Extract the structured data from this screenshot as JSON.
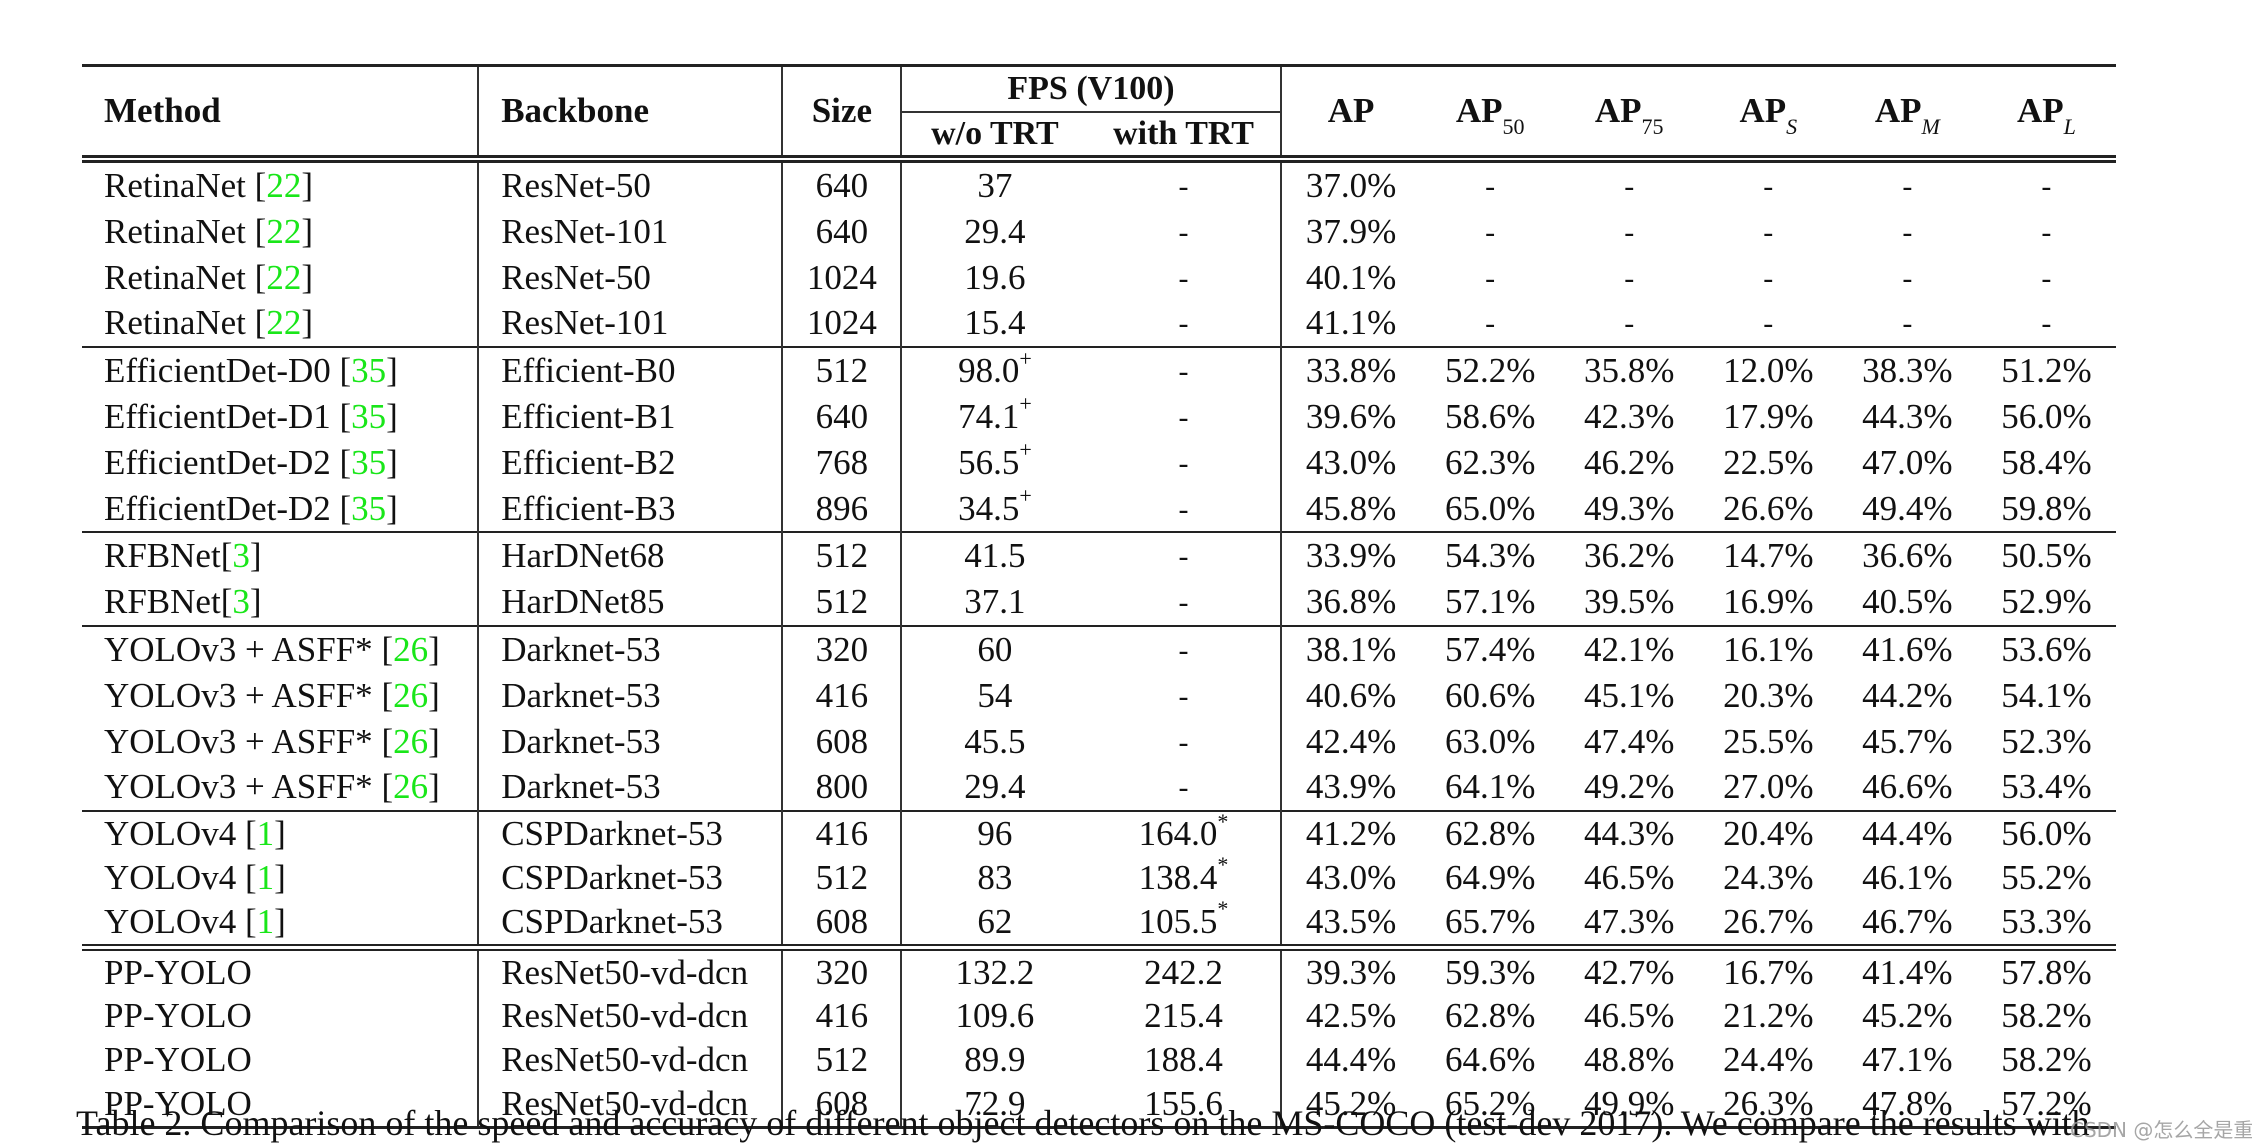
{
  "table": {
    "headers": {
      "method": "Method",
      "backbone": "Backbone",
      "size": "Size",
      "fps_group": "FPS (V100)",
      "fps_wo_trt": "w/o TRT",
      "fps_with_trt": "with TRT",
      "ap": "AP",
      "ap50": {
        "base": "AP",
        "sub": "50"
      },
      "ap75": {
        "base": "AP",
        "sub": "75"
      },
      "aps": {
        "base": "AP",
        "sub": "S"
      },
      "apm": {
        "base": "AP",
        "sub": "M"
      },
      "apl": {
        "base": "AP",
        "sub": "L"
      }
    },
    "groups": [
      {
        "name": "RetinaNet",
        "rows": [
          {
            "method": "RetinaNet ",
            "cite": "22",
            "backbone": "ResNet-50",
            "size": "640",
            "fps": "37",
            "fps_sup": "",
            "fps_trt": "-",
            "fps_trt_sup": "",
            "ap": "37.0%",
            "ap50": "-",
            "ap75": "-",
            "aps": "-",
            "apm": "-",
            "apl": "-"
          },
          {
            "method": "RetinaNet ",
            "cite": "22",
            "backbone": "ResNet-101",
            "size": "640",
            "fps": "29.4",
            "fps_sup": "",
            "fps_trt": "-",
            "fps_trt_sup": "",
            "ap": "37.9%",
            "ap50": "-",
            "ap75": "-",
            "aps": "-",
            "apm": "-",
            "apl": "-"
          },
          {
            "method": "RetinaNet ",
            "cite": "22",
            "backbone": "ResNet-50",
            "size": "1024",
            "fps": "19.6",
            "fps_sup": "",
            "fps_trt": "-",
            "fps_trt_sup": "",
            "ap": "40.1%",
            "ap50": "-",
            "ap75": "-",
            "aps": "-",
            "apm": "-",
            "apl": "-"
          },
          {
            "method": "RetinaNet ",
            "cite": "22",
            "backbone": "ResNet-101",
            "size": "1024",
            "fps": "15.4",
            "fps_sup": "",
            "fps_trt": "-",
            "fps_trt_sup": "",
            "ap": "41.1%",
            "ap50": "-",
            "ap75": "-",
            "aps": "-",
            "apm": "-",
            "apl": "-"
          }
        ]
      },
      {
        "name": "EfficientDet",
        "rows": [
          {
            "method": "EfficientDet-D0 ",
            "cite": "35",
            "backbone": "Efficient-B0",
            "size": "512",
            "fps": "98.0",
            "fps_sup": "+",
            "fps_trt": "-",
            "fps_trt_sup": "",
            "ap": "33.8%",
            "ap50": "52.2%",
            "ap75": "35.8%",
            "aps": "12.0%",
            "apm": "38.3%",
            "apl": "51.2%"
          },
          {
            "method": "EfficientDet-D1 ",
            "cite": "35",
            "backbone": "Efficient-B1",
            "size": "640",
            "fps": "74.1",
            "fps_sup": "+",
            "fps_trt": "-",
            "fps_trt_sup": "",
            "ap": "39.6%",
            "ap50": "58.6%",
            "ap75": "42.3%",
            "aps": "17.9%",
            "apm": "44.3%",
            "apl": "56.0%"
          },
          {
            "method": "EfficientDet-D2 ",
            "cite": "35",
            "backbone": "Efficient-B2",
            "size": "768",
            "fps": "56.5",
            "fps_sup": "+",
            "fps_trt": "-",
            "fps_trt_sup": "",
            "ap": "43.0%",
            "ap50": "62.3%",
            "ap75": "46.2%",
            "aps": "22.5%",
            "apm": "47.0%",
            "apl": "58.4%"
          },
          {
            "method": "EfficientDet-D2 ",
            "cite": "35",
            "backbone": "Efficient-B3",
            "size": "896",
            "fps": "34.5",
            "fps_sup": "+",
            "fps_trt": "-",
            "fps_trt_sup": "",
            "ap": "45.8%",
            "ap50": "65.0%",
            "ap75": "49.3%",
            "aps": "26.6%",
            "apm": "49.4%",
            "apl": "59.8%"
          }
        ]
      },
      {
        "name": "RFBNet",
        "rows": [
          {
            "method": "RFBNet",
            "cite": "3",
            "backbone": "HarDNet68",
            "size": "512",
            "fps": "41.5",
            "fps_sup": "",
            "fps_trt": "-",
            "fps_trt_sup": "",
            "ap": "33.9%",
            "ap50": "54.3%",
            "ap75": "36.2%",
            "aps": "14.7%",
            "apm": "36.6%",
            "apl": "50.5%"
          },
          {
            "method": "RFBNet",
            "cite": "3",
            "backbone": "HarDNet85",
            "size": "512",
            "fps": "37.1",
            "fps_sup": "",
            "fps_trt": "-",
            "fps_trt_sup": "",
            "ap": "36.8%",
            "ap50": "57.1%",
            "ap75": "39.5%",
            "aps": "16.9%",
            "apm": "40.5%",
            "apl": "52.9%"
          }
        ]
      },
      {
        "name": "YOLOv3 + ASFF*",
        "rows": [
          {
            "method": "YOLOv3 + ASFF* ",
            "cite": "26",
            "backbone": "Darknet-53",
            "size": "320",
            "fps": "60",
            "fps_sup": "",
            "fps_trt": "-",
            "fps_trt_sup": "",
            "ap": "38.1%",
            "ap50": "57.4%",
            "ap75": "42.1%",
            "aps": "16.1%",
            "apm": "41.6%",
            "apl": "53.6%"
          },
          {
            "method": "YOLOv3 + ASFF* ",
            "cite": "26",
            "backbone": "Darknet-53",
            "size": "416",
            "fps": "54",
            "fps_sup": "",
            "fps_trt": "-",
            "fps_trt_sup": "",
            "ap": "40.6%",
            "ap50": "60.6%",
            "ap75": "45.1%",
            "aps": "20.3%",
            "apm": "44.2%",
            "apl": "54.1%"
          },
          {
            "method": "YOLOv3 + ASFF* ",
            "cite": "26",
            "backbone": "Darknet-53",
            "size": "608",
            "fps": "45.5",
            "fps_sup": "",
            "fps_trt": "-",
            "fps_trt_sup": "",
            "ap": "42.4%",
            "ap50": "63.0%",
            "ap75": "47.4%",
            "aps": "25.5%",
            "apm": "45.7%",
            "apl": "52.3%"
          },
          {
            "method": "YOLOv3 + ASFF* ",
            "cite": "26",
            "backbone": "Darknet-53",
            "size": "800",
            "fps": "29.4",
            "fps_sup": "",
            "fps_trt": "-",
            "fps_trt_sup": "",
            "ap": "43.9%",
            "ap50": "64.1%",
            "ap75": "49.2%",
            "aps": "27.0%",
            "apm": "46.6%",
            "apl": "53.4%"
          }
        ]
      },
      {
        "name": "YOLOv4",
        "rows": [
          {
            "method": "YOLOv4 ",
            "cite": "1",
            "backbone": "CSPDarknet-53",
            "size": "416",
            "fps": "96",
            "fps_sup": "",
            "fps_trt": "164.0",
            "fps_trt_sup": "*",
            "ap": "41.2%",
            "ap50": "62.8%",
            "ap75": "44.3%",
            "aps": "20.4%",
            "apm": "44.4%",
            "apl": "56.0%"
          },
          {
            "method": "YOLOv4 ",
            "cite": "1",
            "backbone": "CSPDarknet-53",
            "size": "512",
            "fps": "83",
            "fps_sup": "",
            "fps_trt": "138.4",
            "fps_trt_sup": "*",
            "ap": "43.0%",
            "ap50": "64.9%",
            "ap75": "46.5%",
            "aps": "24.3%",
            "apm": "46.1%",
            "apl": "55.2%"
          },
          {
            "method": "YOLOv4 ",
            "cite": "1",
            "backbone": "CSPDarknet-53",
            "size": "608",
            "fps": "62",
            "fps_sup": "",
            "fps_trt": "105.5",
            "fps_trt_sup": "*",
            "ap": "43.5%",
            "ap50": "65.7%",
            "ap75": "47.3%",
            "aps": "26.7%",
            "apm": "46.7%",
            "apl": "53.3%"
          }
        ]
      },
      {
        "name": "PP-YOLO",
        "rows": [
          {
            "method": "PP-YOLO",
            "cite": "",
            "backbone": "ResNet50-vd-dcn",
            "size": "320",
            "fps": "132.2",
            "fps_sup": "",
            "fps_trt": "242.2",
            "fps_trt_sup": "",
            "ap": "39.3%",
            "ap50": "59.3%",
            "ap75": "42.7%",
            "aps": "16.7%",
            "apm": "41.4%",
            "apl": "57.8%"
          },
          {
            "method": "PP-YOLO",
            "cite": "",
            "backbone": "ResNet50-vd-dcn",
            "size": "416",
            "fps": "109.6",
            "fps_sup": "",
            "fps_trt": "215.4",
            "fps_trt_sup": "",
            "ap": "42.5%",
            "ap50": "62.8%",
            "ap75": "46.5%",
            "aps": "21.2%",
            "apm": "45.2%",
            "apl": "58.2%"
          },
          {
            "method": "PP-YOLO",
            "cite": "",
            "backbone": "ResNet50-vd-dcn",
            "size": "512",
            "fps": "89.9",
            "fps_sup": "",
            "fps_trt": "188.4",
            "fps_trt_sup": "",
            "ap": "44.4%",
            "ap50": "64.6%",
            "ap75": "48.8%",
            "aps": "24.4%",
            "apm": "47.1%",
            "apl": "58.2%"
          },
          {
            "method": "PP-YOLO",
            "cite": "",
            "backbone": "ResNet50-vd-dcn",
            "size": "608",
            "fps": "72.9",
            "fps_sup": "",
            "fps_trt": "155.6",
            "fps_trt_sup": "",
            "ap": "45.2%",
            "ap50": "65.2%",
            "ap75": "49.9%",
            "aps": "26.3%",
            "apm": "47.8%",
            "apl": "57.2%"
          }
        ]
      }
    ]
  },
  "caption": "Table 2. Comparison of the speed and accuracy of different object detectors on the MS-COCO (test-dev 2017). We compare the results with",
  "watermark": "CSDN @怎么全是重名",
  "colors": {
    "citation": "#19e619",
    "text": "#111111",
    "rule": "#222222"
  }
}
